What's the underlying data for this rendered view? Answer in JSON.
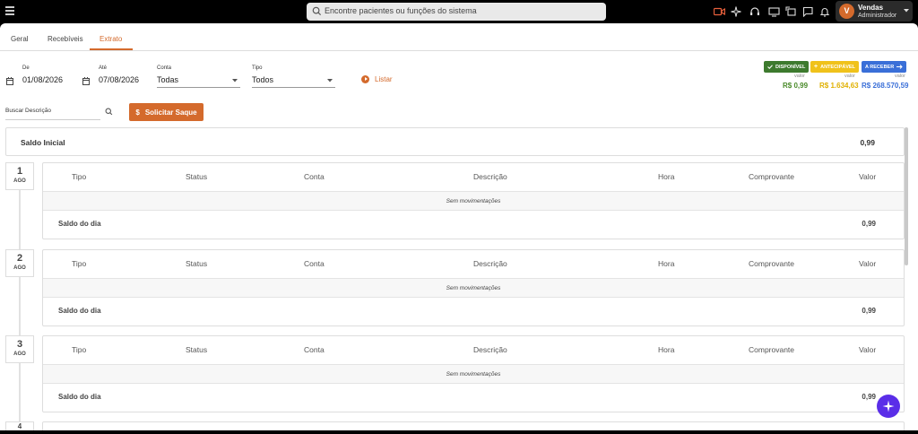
{
  "search": {
    "placeholder": "Encontre pacientes ou funções do sistema"
  },
  "user": {
    "initial": "V",
    "name": "Vendas",
    "role": "Administrador"
  },
  "top_icons": [
    "video-icon",
    "sparkle-icon",
    "headset-icon",
    "screen-share-icon",
    "rotate-icon",
    "chat-icon",
    "bell-icon"
  ],
  "tabs": [
    {
      "label": "Geral",
      "active": false
    },
    {
      "label": "Recebíveis",
      "active": false
    },
    {
      "label": "Extrato",
      "active": true
    }
  ],
  "filters": {
    "de": {
      "label": "De",
      "value": "01/08/2026"
    },
    "ate": {
      "label": "Até",
      "value": "07/08/2026"
    },
    "conta": {
      "label": "Conta",
      "value": "Todas"
    },
    "tipo": {
      "label": "Tipo",
      "value": "Todos"
    },
    "listar_label": "Listar"
  },
  "badges": [
    {
      "label": "DISPONÍVEL",
      "sub": "valor",
      "amount": "R$ 0,99",
      "color": "#3d7a2e",
      "text_color": "#4a8a2a"
    },
    {
      "label": "ANTECIPÁVEL",
      "sub": "valor",
      "amount": "R$ 1.634,63",
      "color": "#f0c21b",
      "text_color": "#e0b000"
    },
    {
      "label": "A RECEBER",
      "sub": "valor",
      "amount": "R$ 268.570,59",
      "color": "#3a6fd8",
      "text_color": "#3a6fd8"
    }
  ],
  "description_search": {
    "label": "Buscar Descrição"
  },
  "solicitar_saque": "Solicitar Saque",
  "saldo_inicial": {
    "label": "Saldo Inicial",
    "value": "0,99"
  },
  "columns": [
    "Tipo",
    "Status",
    "Conta",
    "Descrição",
    "Hora",
    "Comprovante",
    "Valor"
  ],
  "days": [
    {
      "day": "1",
      "month": "AGO",
      "empty_text": "Sem movimentações",
      "balance_label": "Saldo do dia",
      "balance": "0,99"
    },
    {
      "day": "2",
      "month": "AGO",
      "empty_text": "Sem movimentações",
      "balance_label": "Saldo do dia",
      "balance": "0,99"
    },
    {
      "day": "3",
      "month": "AGO",
      "empty_text": "Sem movimentações",
      "balance_label": "Saldo do dia",
      "balance": "0,99"
    }
  ],
  "next_day_partial": "4",
  "colors": {
    "accent": "#d46a2c",
    "fab": "#5a2ee8"
  }
}
